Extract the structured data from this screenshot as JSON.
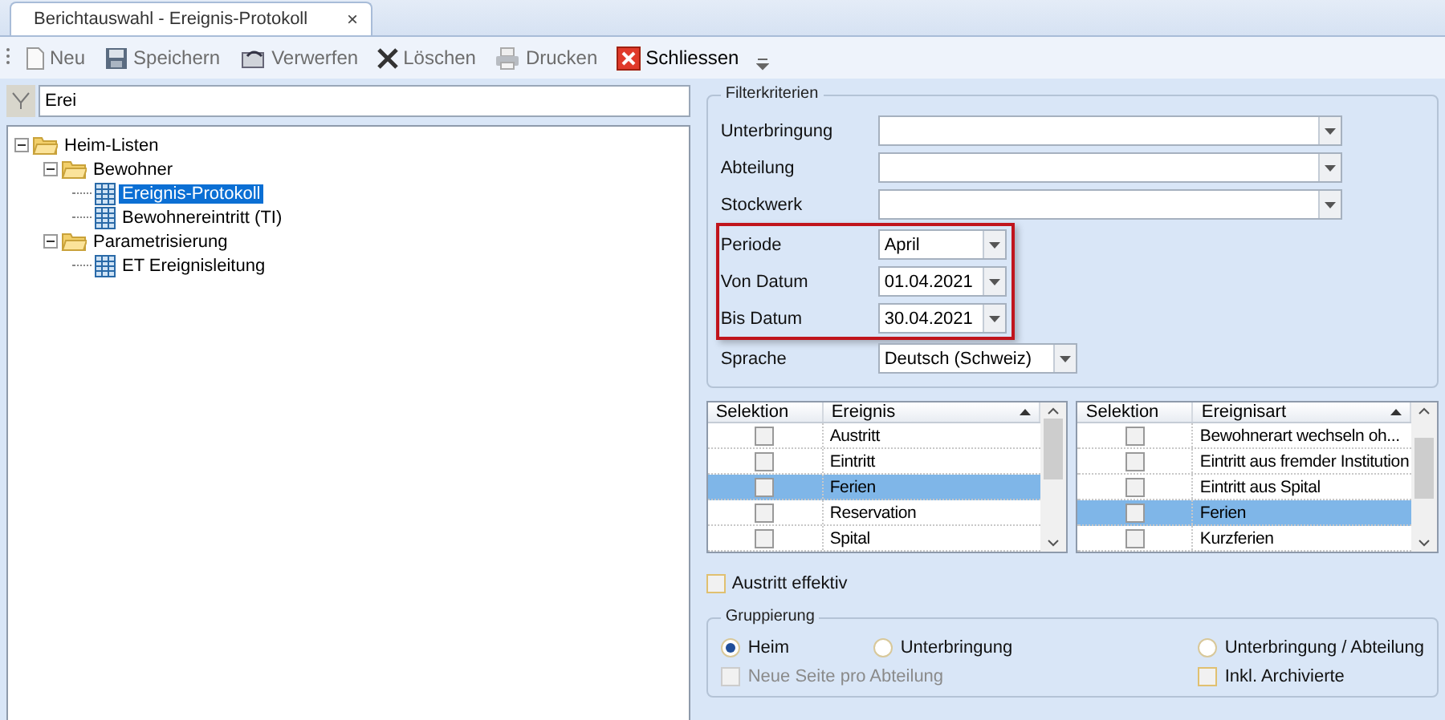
{
  "tab": {
    "title": "Berichtauswahl - Ereignis-Protokoll",
    "close": "×"
  },
  "toolbar": [
    {
      "kind": "new",
      "label": "Neu",
      "disabled": true
    },
    {
      "kind": "save",
      "label": "Speichern",
      "disabled": true
    },
    {
      "kind": "discard",
      "label": "Verwerfen",
      "disabled": true
    },
    {
      "kind": "delete",
      "label": "Löschen",
      "disabled": true
    },
    {
      "kind": "print",
      "label": "Drucken",
      "disabled": true
    },
    {
      "kind": "close",
      "label": "Schliessen",
      "disabled": false
    }
  ],
  "filter": {
    "value": "Erei"
  },
  "tree": [
    {
      "label": "Heim-Listen",
      "kind": "folder",
      "expanded": true,
      "selected": false,
      "children": [
        {
          "label": "Bewohner",
          "kind": "folder",
          "expanded": true,
          "selected": false,
          "children": [
            {
              "label": "Ereignis-Protokoll",
              "kind": "report",
              "selected": true
            },
            {
              "label": "Bewohnereintritt (TI)",
              "kind": "report",
              "selected": false
            }
          ]
        },
        {
          "label": "Parametrisierung",
          "kind": "folder",
          "expanded": true,
          "selected": false,
          "children": [
            {
              "label": "ET Ereignisleitung",
              "kind": "report",
              "selected": false
            }
          ]
        }
      ]
    }
  ],
  "filterkriterien": {
    "title": "Filterkriterien",
    "fields": [
      {
        "label": "Unterbringung",
        "kind": "long",
        "highlighted": false
      },
      {
        "label": "Abteilung",
        "kind": "long",
        "highlighted": false
      },
      {
        "label": "Stockwerk",
        "kind": "long",
        "highlighted": false
      },
      {
        "label": "Periode",
        "value": "April",
        "kind": "short",
        "highlighted": true
      },
      {
        "label": "Von Datum",
        "value": "01.04.2021",
        "kind": "short",
        "highlighted": true
      },
      {
        "label": "Bis Datum",
        "value": "30.04.2021",
        "kind": "short",
        "highlighted": true
      },
      {
        "label": "Sprache",
        "value": "Deutsch (Schweiz)",
        "kind": "medium",
        "highlighted": false
      }
    ]
  },
  "grids": [
    {
      "columns": [
        "Selektion",
        "Ereignis"
      ],
      "rows": [
        {
          "label": "Austritt",
          "checked": false,
          "selected": false
        },
        {
          "label": "Eintritt",
          "checked": false,
          "selected": false
        },
        {
          "label": "Ferien",
          "checked": false,
          "selected": true
        },
        {
          "label": "Reservation",
          "checked": false,
          "selected": false
        },
        {
          "label": "Spital",
          "checked": false,
          "selected": false
        }
      ]
    },
    {
      "columns": [
        "Selektion",
        "Ereignisart"
      ],
      "rows": [
        {
          "label": "Bewohnerart wechseln oh...",
          "checked": false,
          "selected": false
        },
        {
          "label": "Eintritt aus fremder Institution",
          "checked": false,
          "selected": false
        },
        {
          "label": "Eintritt aus Spital",
          "checked": false,
          "selected": false
        },
        {
          "label": "Ferien",
          "checked": false,
          "selected": true
        },
        {
          "label": "Kurzferien",
          "checked": false,
          "selected": false
        }
      ]
    }
  ],
  "austritt_effektiv": {
    "label": "Austritt effektiv",
    "checked": false
  },
  "gruppierung": {
    "title": "Gruppierung",
    "options": [
      {
        "label": "Heim",
        "selected": true
      },
      {
        "label": "Unterbringung",
        "selected": false
      },
      {
        "label": "Unterbringung / Abteilung",
        "selected": false
      }
    ],
    "checkboxes": [
      {
        "label": "Neue Seite pro Abteilung",
        "checked": false,
        "disabled": true
      },
      {
        "label": "Inkl. Archivierte",
        "checked": false,
        "disabled": false
      }
    ]
  }
}
